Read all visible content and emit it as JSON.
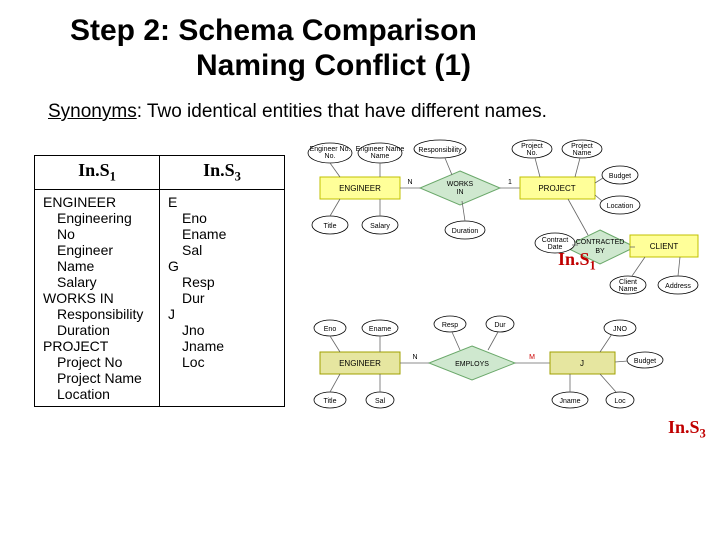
{
  "title_line1": "Step 2:  Schema Comparison",
  "title_line2": "Naming Conflict (1)",
  "synonyms_label": "Synonyms",
  "synonyms_text": ": Two identical entities that have different names.",
  "table": {
    "head": {
      "s1": "In.S",
      "s1_sub": "1",
      "s3": "In.S",
      "s3_sub": "3"
    },
    "s1": {
      "e1": "ENGINEER",
      "e1a": [
        "Engineering No",
        "Engineer Name",
        "Salary"
      ],
      "e2": "WORKS IN",
      "e2a": [
        "Responsibility",
        "Duration"
      ],
      "e3": "PROJECT",
      "e3a": [
        "Project No",
        "Project Name",
        "Location"
      ]
    },
    "s3": {
      "e1": "E",
      "e1a": [
        "Eno",
        "Ename",
        "Sal"
      ],
      "e2": "G",
      "e2a": [
        "Resp",
        "Dur"
      ],
      "e3": "J",
      "e3a": [
        "Jno",
        "Jname",
        "Loc"
      ]
    }
  },
  "diagram1": {
    "engineer": "ENGINEER",
    "worksin": "WORKS IN",
    "project": "PROJECT",
    "attrs_eng": [
      "Engineer No.",
      "Engineer Name",
      "Title",
      "Salary"
    ],
    "attrs_wrk": [
      "Responsibility",
      "Duration"
    ],
    "attrs_prj": [
      "Project No.",
      "Project Name",
      "Budget",
      "Location"
    ],
    "contracted": "CONTRACTED BY",
    "client": "CLIENT",
    "attrs_cli": [
      "Contract Date",
      "Client Name",
      "Address"
    ],
    "card_n": "N",
    "card_1": "1"
  },
  "diagram3": {
    "engineer": "ENGINEER",
    "employs": "EMPLOYS",
    "j": "J",
    "attrs_eng": [
      "Eno",
      "Ename",
      "Title",
      "Sal"
    ],
    "attrs_emp": [
      "Resp",
      "Dur"
    ],
    "attrs_j": [
      "JNO",
      "Jname",
      "Budget",
      "Loc"
    ],
    "card_n": "N",
    "card_m": "M"
  },
  "labels": {
    "s1": "In.S",
    "s1_sub": "1",
    "s3": "In.S",
    "s3_sub": "3"
  }
}
